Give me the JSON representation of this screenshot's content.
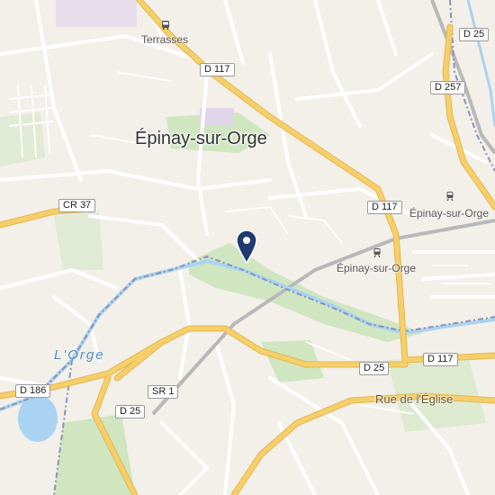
{
  "map": {
    "towns": {
      "main": "Épinay-sur-Orge"
    },
    "places": {
      "terrasses": "Terrasses"
    },
    "stations": {
      "east": "Épinay-sur-Orge",
      "rail": "Épinay-sur-Orge"
    },
    "river": "L'Orge",
    "streets": {
      "eglise": "Rue de l'Église"
    },
    "roads": {
      "d117_top": "D 117",
      "d117_right": "D 117",
      "d117_bottom": "D 117",
      "d257": "D 257",
      "d25_top": "D 25",
      "d25_mid": "D 25",
      "d25_left": "D 25",
      "cr37": "CR 37",
      "d186": "D 186",
      "sr1": "SR 1"
    },
    "marker": "location-pin",
    "colors": {
      "background": "#f3efe9",
      "major_road": "#f6cf6a",
      "minor_road": "#ffffff",
      "water": "#a9d3f1",
      "park": "#cfe6c0",
      "railway": "#b8b8b8",
      "boundary": "#8a93b8",
      "pin": "#1e3a6e"
    }
  }
}
